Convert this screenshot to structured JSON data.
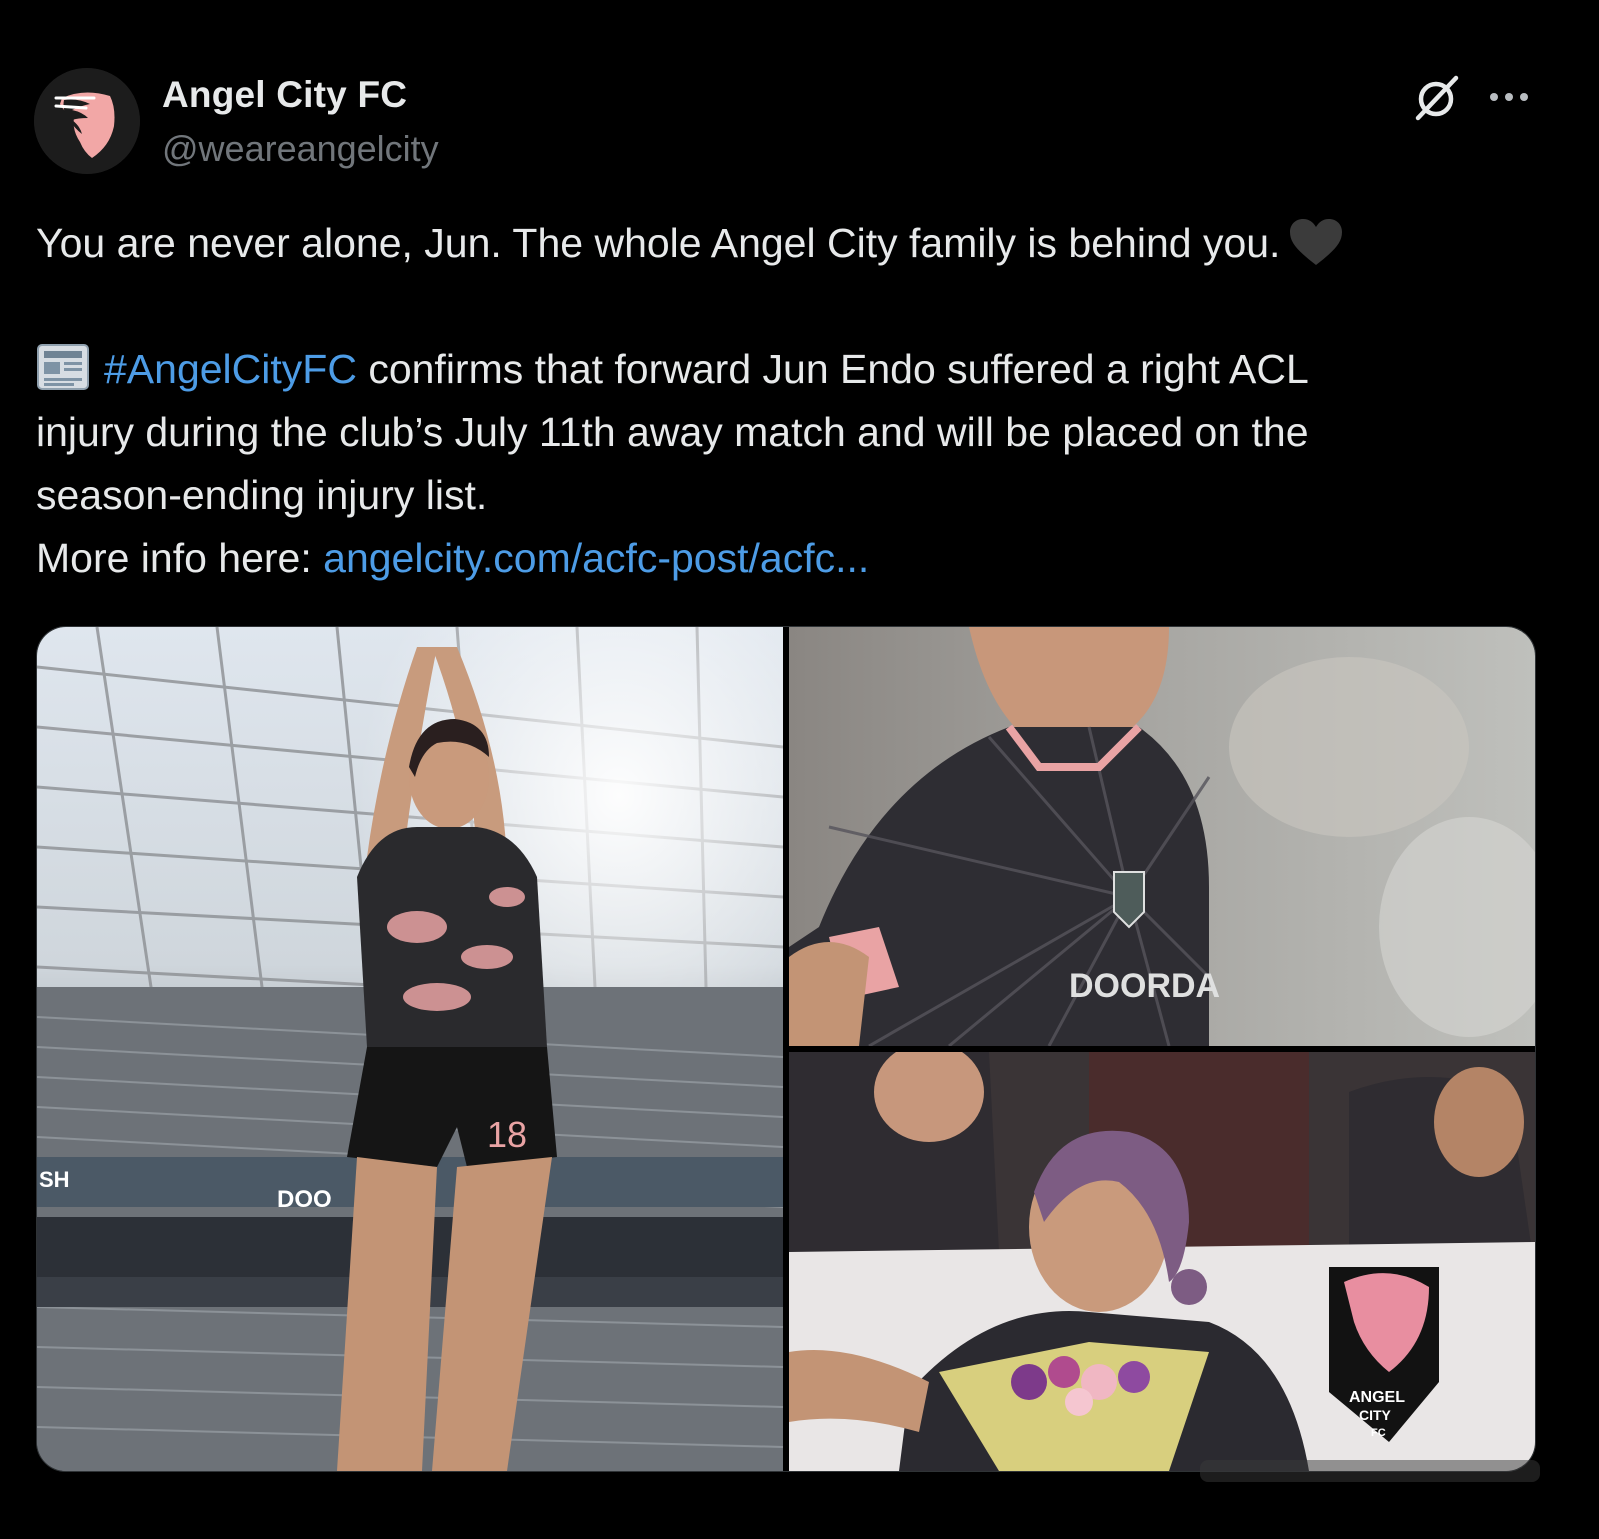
{
  "account": {
    "display_name": "Angel City FC",
    "handle": "@weareangelcity"
  },
  "tweet": {
    "line_1": "You are never alone, Jun. The whole Angel City family is behind you.",
    "hashtag": "#AngelCityFC",
    "line_2_rest": " confirms that forward Jun Endo suffered a right ACL",
    "line_3": "injury during the club’s July 11th away match and will be placed on the",
    "line_4": "season-ending injury list.",
    "more_info_label": "More info here: ",
    "link_text": "angelcity.com/acfc-post/acfc..."
  },
  "media": {
    "photo_1": {
      "jersey_number": "18",
      "banner_text": "SH",
      "sponsor_text": "DOO"
    },
    "photo_2": {
      "sponsor_text": "DOORDA"
    },
    "photo_3": {
      "flag_text_1": "ANGEL",
      "flag_text_2": "CITY",
      "flag_text_3": "FC"
    }
  },
  "icons": {
    "avatar": "angel-city-logo",
    "grok": "grok-icon",
    "more": "more-options-icon",
    "heart": "black-heart-emoji",
    "news": "newspaper-emoji"
  },
  "colors": {
    "background": "#000000",
    "text": "#e7e9ea",
    "secondary_text": "#71767b",
    "link": "#4d9ce6",
    "brand_pink": "#f2a7a6"
  }
}
